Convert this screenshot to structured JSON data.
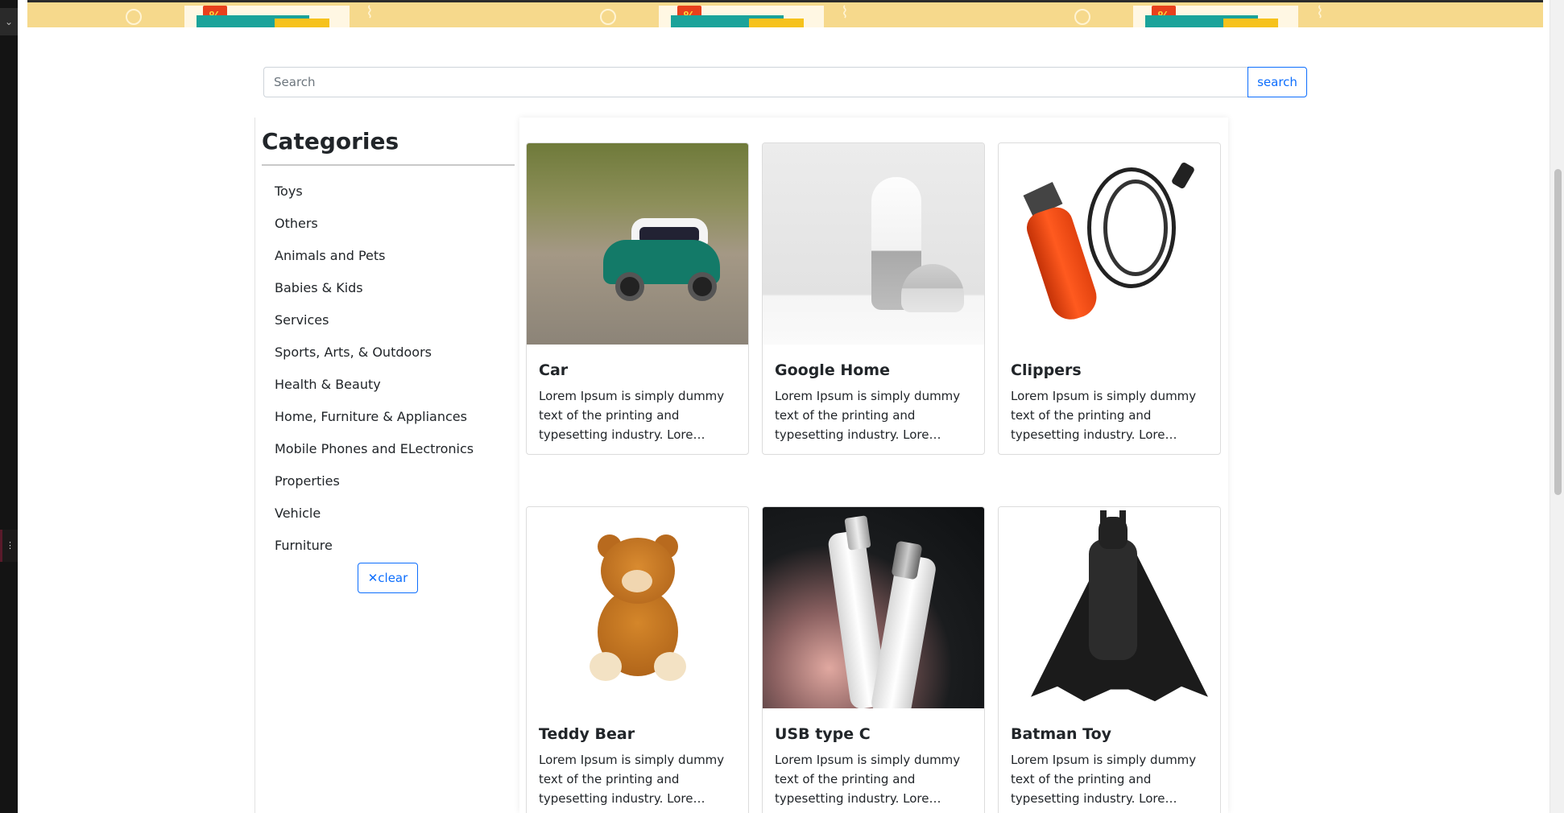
{
  "search": {
    "placeholder": "Search",
    "button_label": "search"
  },
  "sidebar": {
    "title": "Categories",
    "items": [
      "Toys",
      "Others",
      "Animals and Pets",
      "Babies & Kids",
      "Services",
      "Sports, Arts, & Outdoors",
      "Health & Beauty",
      "Home, Furniture & Appliances",
      "Mobile Phones and ELectronics",
      "Properties",
      "Vehicle",
      "Furniture"
    ],
    "clear_icon": "✕",
    "clear_label": "clear"
  },
  "products": [
    {
      "title": "Car",
      "description": "Lorem Ipsum is simply dummy text of the printing and typesetting industry. Lore…",
      "image": "toy-car-image"
    },
    {
      "title": "Google Home",
      "description": "Lorem Ipsum is simply dummy text of the printing and typesetting industry. Lore…",
      "image": "google-home-image"
    },
    {
      "title": "Clippers",
      "description": "Lorem Ipsum is simply dummy text of the printing and typesetting industry. Lore…",
      "image": "hair-clippers-image"
    },
    {
      "title": "Teddy Bear",
      "description": "Lorem Ipsum is simply dummy text of the printing and typesetting industry. Lore…",
      "image": "teddy-bear-image"
    },
    {
      "title": "USB type C",
      "description": "Lorem Ipsum is simply dummy text of the printing and typesetting industry. Lore…",
      "image": "usb-c-cable-image"
    },
    {
      "title": "Batman Toy",
      "description": "Lorem Ipsum is simply dummy text of the printing and typesetting industry. Lore…",
      "image": "batman-figure-image"
    }
  ],
  "banner": {
    "badge_symbol": "%"
  },
  "colors": {
    "primary": "#0d6efd",
    "banner_bg": "#f6d98c",
    "badge": "#e8401c"
  }
}
